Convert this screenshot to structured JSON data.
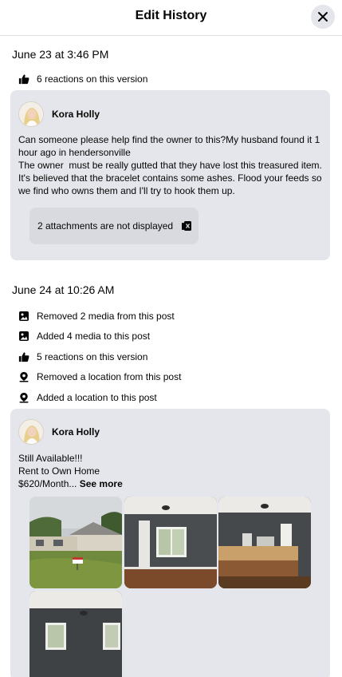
{
  "header": {
    "title": "Edit History"
  },
  "versions": [
    {
      "date": "June 23 at 3:46 PM",
      "changes": [
        {
          "icon": "thumbs-up-icon",
          "text": "6 reactions on this version"
        }
      ],
      "post": {
        "author": "Kora Holly",
        "text": "Can someone please help find the owner to this?My husband found it 1 hour ago in hendersonville\nThe owner  must be really gutted that they have lost this treasured item. It's believed that the bracelet contains some ashes. Flood your feeds so we find who owns them and I'll try to hook them up.",
        "attachments_notice": "2 attachments are not displayed"
      }
    },
    {
      "date": "June 24 at 10:26 AM",
      "changes": [
        {
          "icon": "photo-icon",
          "text": "Removed 2 media from this post"
        },
        {
          "icon": "photo-icon",
          "text": "Added 4 media to this post"
        },
        {
          "icon": "thumbs-up-icon",
          "text": "5 reactions on this version"
        },
        {
          "icon": "location-pin-icon",
          "text": "Removed a location from this post"
        },
        {
          "icon": "location-pin-icon",
          "text": "Added a location to this post"
        }
      ],
      "post": {
        "author": "Kora Holly",
        "text": "Still Available!!!\nRent to Own Home\n$620/Month... ",
        "see_more": "See more"
      }
    }
  ],
  "colors": {
    "card_bg": "#e4e6eb",
    "attachment_bg": "#d8dadf",
    "text": "#050505",
    "divider": "#dadde1"
  }
}
